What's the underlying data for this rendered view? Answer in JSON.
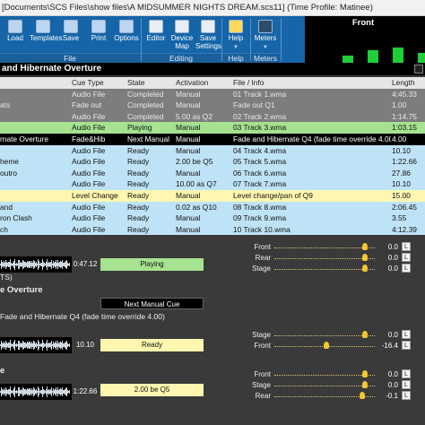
{
  "window": {
    "title": "[Documents\\SCS Files\\show files\\A MIDSUMMER NIGHTS DREAM.scs11] (Time Profile: Matinee)"
  },
  "ribbon": {
    "file_buttons": [
      {
        "label": "Load",
        "icon": "folder-icon"
      },
      {
        "label": "Templates",
        "icon": "templates-icon"
      },
      {
        "label": "Save",
        "icon": "save-icon"
      },
      {
        "label": "Print",
        "icon": "print-icon"
      },
      {
        "label": "Options",
        "icon": "options-icon"
      }
    ],
    "editing_buttons": [
      {
        "label": "Editor",
        "icon": "editor-icon"
      },
      {
        "label": "Device Map",
        "icon": "device-map-icon"
      },
      {
        "label": "Save Settings",
        "icon": "save-settings-icon"
      }
    ],
    "help_button": {
      "label": "Help",
      "icon": "help-icon"
    },
    "meters_button": {
      "label": "Meters",
      "icon": "meters-icon"
    },
    "groups": {
      "file": "File",
      "editing": "Editing",
      "help": "Help",
      "meters": "Meters"
    },
    "meter_title": "Front",
    "meter_levels": [
      0.25,
      0.45,
      0.55,
      0.35
    ]
  },
  "cue_header": {
    "title": "and Hibernate Overture"
  },
  "table": {
    "columns": [
      "",
      "Cue Type",
      "State",
      "Activation",
      "File / Info",
      "Length"
    ],
    "rows": [
      {
        "state_class": "done",
        "cells": [
          "",
          "Audio File",
          "Completed",
          "Manual",
          "01 Track 1.wma",
          "4:45.33"
        ]
      },
      {
        "state_class": "done",
        "cells": [
          "ats",
          "Fade out",
          "Completed",
          "Manual",
          "Fade out Q1",
          "1.00"
        ]
      },
      {
        "state_class": "done",
        "cells": [
          "",
          "Audio File",
          "Completed",
          "5.00 as Q2",
          "02 Track 2.wma",
          "1:14.75"
        ]
      },
      {
        "state_class": "play",
        "cells": [
          "",
          "Audio File",
          "Playing",
          "Manual",
          "03 Track 3.wma",
          "1:03.15"
        ]
      },
      {
        "state_class": "next",
        "cells": [
          "rnate Overture",
          "Fade&Hib",
          "Next Manual",
          "Manual",
          "Fade and Hibernate Q4  (fade time override 4.00)",
          "4.00"
        ]
      },
      {
        "state_class": "ready",
        "cells": [
          "",
          "Audio File",
          "Ready",
          "Manual",
          "04 Track 4.wma",
          "10.10"
        ]
      },
      {
        "state_class": "ready",
        "cells": [
          "heme",
          "Audio File",
          "Ready",
          "2.00 be Q5",
          "05 Track 5.wma",
          "1:22.66"
        ]
      },
      {
        "state_class": "ready",
        "cells": [
          "outro",
          "Audio File",
          "Ready",
          "Manual",
          "06 Track 6.wma",
          "27.86"
        ]
      },
      {
        "state_class": "ready",
        "cells": [
          "",
          "Audio File",
          "Ready",
          "10.00 as Q7",
          "07 Track 7.wma",
          "10.10"
        ]
      },
      {
        "state_class": "level",
        "cells": [
          "",
          "Level Change",
          "Ready",
          "Manual",
          "Level change/pan of Q9",
          "15.00"
        ]
      },
      {
        "state_class": "ready",
        "cells": [
          "and",
          "Audio File",
          "Ready",
          "0.02 as Q10",
          "08 Track 8.wma",
          "2:06.45"
        ]
      },
      {
        "state_class": "ready",
        "cells": [
          "ron Clash",
          "Audio File",
          "Ready",
          "Manual",
          "09 Track 9.wma",
          "3.55"
        ]
      },
      {
        "state_class": "ready",
        "cells": [
          "ch",
          "Audio File",
          "Ready",
          "Manual",
          "10 Track 10.wma",
          "4:12.39"
        ]
      }
    ]
  },
  "panels": {
    "playing": {
      "time": "0:47.12",
      "status": "Playing",
      "suffix": "TS)",
      "meters": [
        {
          "label": "Front",
          "value": "0.0",
          "fill": 0.92
        },
        {
          "label": "Rear",
          "value": "0.0",
          "fill": 0.92
        },
        {
          "label": "Stage",
          "value": "0.0",
          "fill": 0.92
        }
      ]
    },
    "next": {
      "title": "e Overture",
      "button": "Next Manual Cue",
      "desc": "Fade and Hibernate Q4  (fade time override 4.00)"
    },
    "ready1": {
      "time": "10.10",
      "status": "Ready",
      "meters": [
        {
          "label": "Stage",
          "value": "0.0",
          "fill": 0.92
        },
        {
          "label": "Front",
          "value": "-16.4",
          "fill": 0.52
        }
      ]
    },
    "ready2": {
      "title": "e",
      "time": "1:22.66",
      "status": "2.00 be Q5",
      "meters": [
        {
          "label": "Front",
          "value": "0.0",
          "fill": 0.92
        },
        {
          "label": "Stage",
          "value": "0.0",
          "fill": 0.92
        },
        {
          "label": "Rear",
          "value": "-0.1",
          "fill": 0.9
        }
      ]
    },
    "lr_label": "L"
  }
}
